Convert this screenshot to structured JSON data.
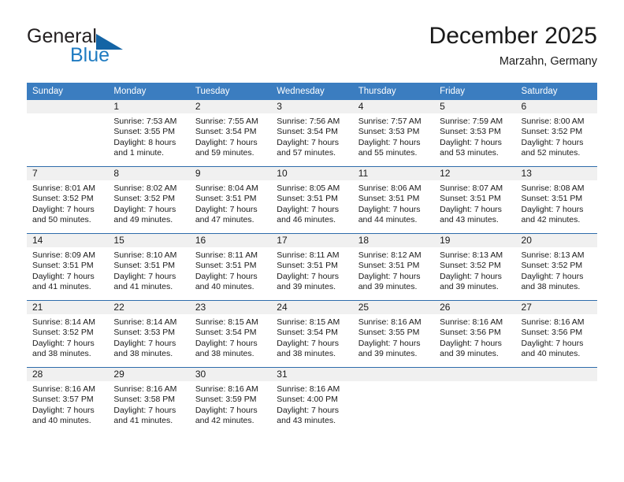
{
  "logo": {
    "word_top": "General",
    "word_bottom": "Blue",
    "triangle_color": "#1464a5",
    "blue_color": "#1f7bc1"
  },
  "header": {
    "title": "December 2025",
    "location": "Marzahn, Germany",
    "accent_color": "#3b7dc0"
  },
  "weekday_headers": [
    "Sunday",
    "Monday",
    "Tuesday",
    "Wednesday",
    "Thursday",
    "Friday",
    "Saturday"
  ],
  "labels": {
    "sunrise_prefix": "Sunrise:",
    "sunset_prefix": "Sunset:",
    "daylight_prefix": "Daylight:"
  },
  "weeks": [
    [
      {
        "day": "",
        "empty": true,
        "sunrise": "",
        "sunset": "",
        "daylight_line1": "",
        "daylight_line2": ""
      },
      {
        "day": "1",
        "sunrise": "Sunrise: 7:53 AM",
        "sunset": "Sunset: 3:55 PM",
        "daylight_line1": "Daylight: 8 hours",
        "daylight_line2": "and 1 minute."
      },
      {
        "day": "2",
        "sunrise": "Sunrise: 7:55 AM",
        "sunset": "Sunset: 3:54 PM",
        "daylight_line1": "Daylight: 7 hours",
        "daylight_line2": "and 59 minutes."
      },
      {
        "day": "3",
        "sunrise": "Sunrise: 7:56 AM",
        "sunset": "Sunset: 3:54 PM",
        "daylight_line1": "Daylight: 7 hours",
        "daylight_line2": "and 57 minutes."
      },
      {
        "day": "4",
        "sunrise": "Sunrise: 7:57 AM",
        "sunset": "Sunset: 3:53 PM",
        "daylight_line1": "Daylight: 7 hours",
        "daylight_line2": "and 55 minutes."
      },
      {
        "day": "5",
        "sunrise": "Sunrise: 7:59 AM",
        "sunset": "Sunset: 3:53 PM",
        "daylight_line1": "Daylight: 7 hours",
        "daylight_line2": "and 53 minutes."
      },
      {
        "day": "6",
        "sunrise": "Sunrise: 8:00 AM",
        "sunset": "Sunset: 3:52 PM",
        "daylight_line1": "Daylight: 7 hours",
        "daylight_line2": "and 52 minutes."
      }
    ],
    [
      {
        "day": "7",
        "sunrise": "Sunrise: 8:01 AM",
        "sunset": "Sunset: 3:52 PM",
        "daylight_line1": "Daylight: 7 hours",
        "daylight_line2": "and 50 minutes."
      },
      {
        "day": "8",
        "sunrise": "Sunrise: 8:02 AM",
        "sunset": "Sunset: 3:52 PM",
        "daylight_line1": "Daylight: 7 hours",
        "daylight_line2": "and 49 minutes."
      },
      {
        "day": "9",
        "sunrise": "Sunrise: 8:04 AM",
        "sunset": "Sunset: 3:51 PM",
        "daylight_line1": "Daylight: 7 hours",
        "daylight_line2": "and 47 minutes."
      },
      {
        "day": "10",
        "sunrise": "Sunrise: 8:05 AM",
        "sunset": "Sunset: 3:51 PM",
        "daylight_line1": "Daylight: 7 hours",
        "daylight_line2": "and 46 minutes."
      },
      {
        "day": "11",
        "sunrise": "Sunrise: 8:06 AM",
        "sunset": "Sunset: 3:51 PM",
        "daylight_line1": "Daylight: 7 hours",
        "daylight_line2": "and 44 minutes."
      },
      {
        "day": "12",
        "sunrise": "Sunrise: 8:07 AM",
        "sunset": "Sunset: 3:51 PM",
        "daylight_line1": "Daylight: 7 hours",
        "daylight_line2": "and 43 minutes."
      },
      {
        "day": "13",
        "sunrise": "Sunrise: 8:08 AM",
        "sunset": "Sunset: 3:51 PM",
        "daylight_line1": "Daylight: 7 hours",
        "daylight_line2": "and 42 minutes."
      }
    ],
    [
      {
        "day": "14",
        "sunrise": "Sunrise: 8:09 AM",
        "sunset": "Sunset: 3:51 PM",
        "daylight_line1": "Daylight: 7 hours",
        "daylight_line2": "and 41 minutes."
      },
      {
        "day": "15",
        "sunrise": "Sunrise: 8:10 AM",
        "sunset": "Sunset: 3:51 PM",
        "daylight_line1": "Daylight: 7 hours",
        "daylight_line2": "and 41 minutes."
      },
      {
        "day": "16",
        "sunrise": "Sunrise: 8:11 AM",
        "sunset": "Sunset: 3:51 PM",
        "daylight_line1": "Daylight: 7 hours",
        "daylight_line2": "and 40 minutes."
      },
      {
        "day": "17",
        "sunrise": "Sunrise: 8:11 AM",
        "sunset": "Sunset: 3:51 PM",
        "daylight_line1": "Daylight: 7 hours",
        "daylight_line2": "and 39 minutes."
      },
      {
        "day": "18",
        "sunrise": "Sunrise: 8:12 AM",
        "sunset": "Sunset: 3:51 PM",
        "daylight_line1": "Daylight: 7 hours",
        "daylight_line2": "and 39 minutes."
      },
      {
        "day": "19",
        "sunrise": "Sunrise: 8:13 AM",
        "sunset": "Sunset: 3:52 PM",
        "daylight_line1": "Daylight: 7 hours",
        "daylight_line2": "and 39 minutes."
      },
      {
        "day": "20",
        "sunrise": "Sunrise: 8:13 AM",
        "sunset": "Sunset: 3:52 PM",
        "daylight_line1": "Daylight: 7 hours",
        "daylight_line2": "and 38 minutes."
      }
    ],
    [
      {
        "day": "21",
        "sunrise": "Sunrise: 8:14 AM",
        "sunset": "Sunset: 3:52 PM",
        "daylight_line1": "Daylight: 7 hours",
        "daylight_line2": "and 38 minutes."
      },
      {
        "day": "22",
        "sunrise": "Sunrise: 8:14 AM",
        "sunset": "Sunset: 3:53 PM",
        "daylight_line1": "Daylight: 7 hours",
        "daylight_line2": "and 38 minutes."
      },
      {
        "day": "23",
        "sunrise": "Sunrise: 8:15 AM",
        "sunset": "Sunset: 3:54 PM",
        "daylight_line1": "Daylight: 7 hours",
        "daylight_line2": "and 38 minutes."
      },
      {
        "day": "24",
        "sunrise": "Sunrise: 8:15 AM",
        "sunset": "Sunset: 3:54 PM",
        "daylight_line1": "Daylight: 7 hours",
        "daylight_line2": "and 38 minutes."
      },
      {
        "day": "25",
        "sunrise": "Sunrise: 8:16 AM",
        "sunset": "Sunset: 3:55 PM",
        "daylight_line1": "Daylight: 7 hours",
        "daylight_line2": "and 39 minutes."
      },
      {
        "day": "26",
        "sunrise": "Sunrise: 8:16 AM",
        "sunset": "Sunset: 3:56 PM",
        "daylight_line1": "Daylight: 7 hours",
        "daylight_line2": "and 39 minutes."
      },
      {
        "day": "27",
        "sunrise": "Sunrise: 8:16 AM",
        "sunset": "Sunset: 3:56 PM",
        "daylight_line1": "Daylight: 7 hours",
        "daylight_line2": "and 40 minutes."
      }
    ],
    [
      {
        "day": "28",
        "sunrise": "Sunrise: 8:16 AM",
        "sunset": "Sunset: 3:57 PM",
        "daylight_line1": "Daylight: 7 hours",
        "daylight_line2": "and 40 minutes."
      },
      {
        "day": "29",
        "sunrise": "Sunrise: 8:16 AM",
        "sunset": "Sunset: 3:58 PM",
        "daylight_line1": "Daylight: 7 hours",
        "daylight_line2": "and 41 minutes."
      },
      {
        "day": "30",
        "sunrise": "Sunrise: 8:16 AM",
        "sunset": "Sunset: 3:59 PM",
        "daylight_line1": "Daylight: 7 hours",
        "daylight_line2": "and 42 minutes."
      },
      {
        "day": "31",
        "sunrise": "Sunrise: 8:16 AM",
        "sunset": "Sunset: 4:00 PM",
        "daylight_line1": "Daylight: 7 hours",
        "daylight_line2": "and 43 minutes."
      },
      {
        "day": "",
        "empty": true,
        "sunrise": "",
        "sunset": "",
        "daylight_line1": "",
        "daylight_line2": ""
      },
      {
        "day": "",
        "empty": true,
        "sunrise": "",
        "sunset": "",
        "daylight_line1": "",
        "daylight_line2": ""
      },
      {
        "day": "",
        "empty": true,
        "sunrise": "",
        "sunset": "",
        "daylight_line1": "",
        "daylight_line2": ""
      }
    ]
  ]
}
